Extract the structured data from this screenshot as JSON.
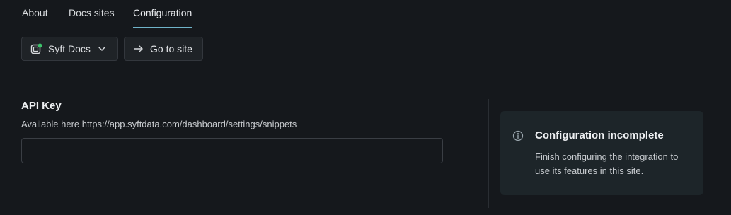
{
  "tabs": [
    {
      "label": "About"
    },
    {
      "label": "Docs sites"
    },
    {
      "label": "Configuration",
      "active": true
    }
  ],
  "toolbar": {
    "site_selector_label": "Syft Docs",
    "site_icon": "site-status-icon",
    "go_to_site_label": "Go to site",
    "go_to_site_icon": "arrow-right-icon"
  },
  "form": {
    "api_key_title": "API Key",
    "api_key_description": "Available here https://app.syftdata.com/dashboard/settings/snippets",
    "api_key_value": "",
    "api_key_placeholder": ""
  },
  "callout": {
    "icon": "info-icon",
    "title": "Configuration incomplete",
    "body": "Finish configuring the integration to use its features in this site."
  },
  "colors": {
    "background": "#15181c",
    "accent": "#6fb3c9",
    "status_dot": "#3cc36a",
    "callout_bg": "#1d2529"
  }
}
